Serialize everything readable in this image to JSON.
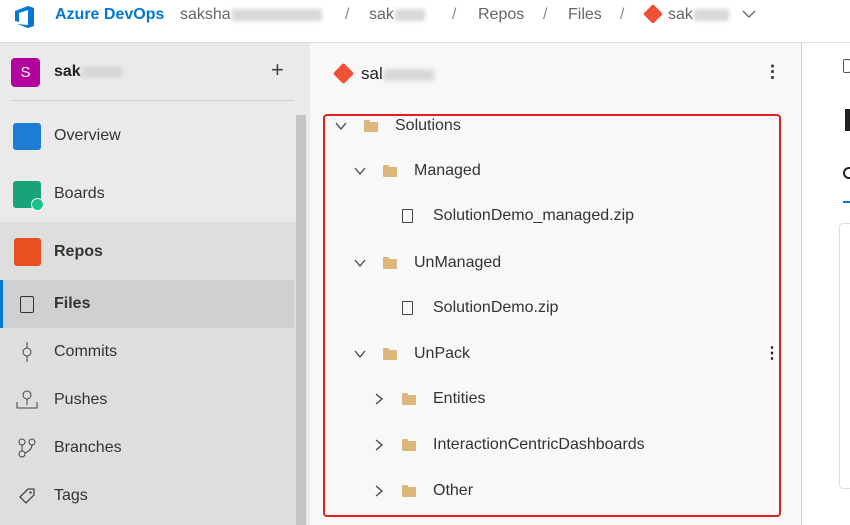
{
  "topbar": {
    "brand": "Azure DevOps",
    "org": "saksha",
    "project": "sak",
    "crumb_repos": "Repos",
    "crumb_files": "Files",
    "repo": "sak",
    "separator": "/"
  },
  "sidebar": {
    "project_initial": "S",
    "project_name": "sak",
    "add": "+",
    "items": [
      {
        "label": "Overview"
      },
      {
        "label": "Boards"
      },
      {
        "label": "Repos"
      },
      {
        "label": "Files"
      },
      {
        "label": "Commits"
      },
      {
        "label": "Pushes"
      },
      {
        "label": "Branches"
      },
      {
        "label": "Tags"
      }
    ]
  },
  "middle": {
    "repo_name": "sal",
    "more": "⋮"
  },
  "tree": [
    {
      "label": "Solutions",
      "type": "folder",
      "expanded": true
    },
    {
      "label": "Managed",
      "type": "folder",
      "expanded": true
    },
    {
      "label": "SolutionDemo_managed.zip",
      "type": "file"
    },
    {
      "label": "UnManaged",
      "type": "folder",
      "expanded": true
    },
    {
      "label": "SolutionDemo.zip",
      "type": "file"
    },
    {
      "label": "UnPack",
      "type": "folder",
      "expanded": true
    },
    {
      "label": "Entities",
      "type": "folder",
      "expanded": false
    },
    {
      "label": "InteractionCentricDashboards",
      "type": "folder",
      "expanded": false
    },
    {
      "label": "Other",
      "type": "folder",
      "expanded": false
    }
  ],
  "colors": {
    "brand": "#0078d4",
    "highlight": "#e02020",
    "git": "#f05033",
    "project_avatar": "#b4009e"
  }
}
